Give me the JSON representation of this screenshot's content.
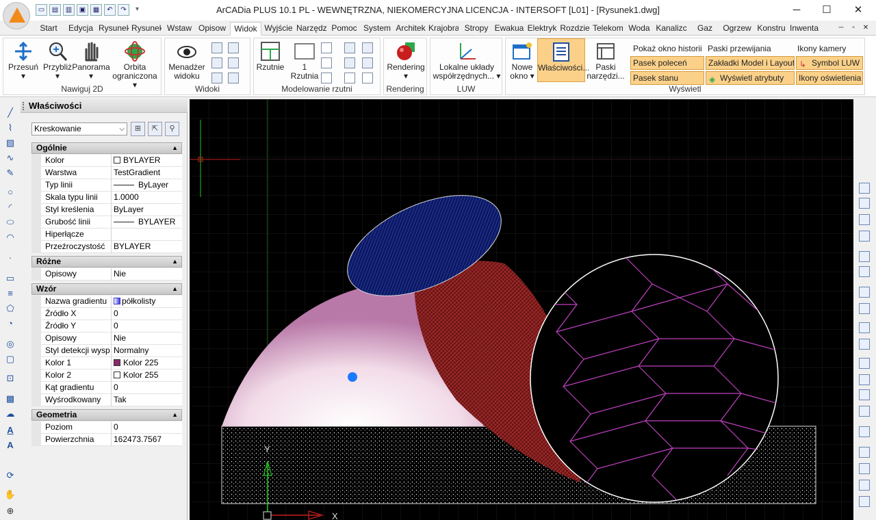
{
  "titlebar": {
    "title": "ArCADia PLUS 10.1 PL - WEWNĘTRZNA, NIEKOMERCYJNA LICENCJA - INTERSOFT [L01] - [Rysunek1.dwg]",
    "minimize": "─",
    "maximize": "☐",
    "close": "✕"
  },
  "tabs": [
    "Start",
    "Edycja",
    "Rysunek",
    "Rysunek",
    "Wstaw",
    "Opisow",
    "Widok",
    "Wyjście",
    "Narzędz",
    "Pomoc",
    "System",
    "Architek",
    "Krajobra",
    "Stropy",
    "Ewakua",
    "Elektryk",
    "Rozdzie",
    "Telekom",
    "Woda",
    "Kanalizc",
    "Gaz",
    "Ogrzew",
    "Konstru",
    "Inwenta"
  ],
  "active_tab": "Widok",
  "ribbon": {
    "nawiguj": {
      "label": "Nawiguj 2D",
      "przesun": "Przesuń",
      "przybliz": "Przybliż",
      "panorama": "Panorama",
      "orbita": "Orbita",
      "ograniczona": "ograniczona"
    },
    "widoki": {
      "label": "Widoki",
      "menedzer": "Menadżer",
      "widoku": "widoku"
    },
    "model": {
      "label": "Modelowanie rzutni",
      "rzutnie": "Rzutnie",
      "jeden": "1",
      "rzutnia": "Rzutnia"
    },
    "rendering": {
      "label": "Rendering",
      "btn": "Rendering"
    },
    "luw": {
      "label": "LUW",
      "lokalne": "Lokalne układy",
      "wspol": "współrzędnych..."
    },
    "wyswietl": {
      "label": "Wyświetl",
      "nowe": "Nowe",
      "okno": "okno",
      "wlasciwosci": "Właściwości...",
      "paski": "Paski",
      "narzedzi": "narzędzi...",
      "pokaz_okno": "Pokaż okno historii",
      "paski_przew": "Paski przewijania",
      "ikony_kamery": "Ikony kamery",
      "pasek_polecen": "Pasek poleceń",
      "zakladki": "Zakładki Model i Layout",
      "symbol_luw": "Symbol LUW",
      "pasek_stanu": "Pasek stanu",
      "wyswietl_atr": "Wyświetl atrybuty",
      "ikony_osw": "Ikony oświetlenia"
    }
  },
  "panel": {
    "title": "Właściwości",
    "selector": "Kreskowanie",
    "sections": [
      {
        "name": "Ogólnie",
        "rows": [
          [
            "Kolor",
            "BYLAYER"
          ],
          [
            "Warstwa",
            "TestGradient"
          ],
          [
            "Typ linii",
            "ByLayer"
          ],
          [
            "Skala typu linii",
            "1.0000"
          ],
          [
            "Styl kreślenia",
            "ByLayer"
          ],
          [
            "Grubość linii",
            "BYLAYER"
          ],
          [
            "Hiperłącze",
            ""
          ],
          [
            "Przeźroczystość",
            "BYLAYER"
          ]
        ]
      },
      {
        "name": "Różne",
        "rows": [
          [
            "Opisowy",
            "Nie"
          ]
        ]
      },
      {
        "name": "Wzór",
        "rows": [
          [
            "Nazwa gradientu",
            "półkolisty"
          ],
          [
            "Źródło X",
            "0"
          ],
          [
            "Źródło Y",
            "0"
          ],
          [
            "Opisowy",
            "Nie"
          ],
          [
            "Styl detekcji wysp",
            "Normalny"
          ],
          [
            "Kolor 1",
            "Kolor 225"
          ],
          [
            "Kolor 2",
            "Kolor 255"
          ],
          [
            "Kąt gradientu",
            "0"
          ],
          [
            "Wyśrodkowany",
            "Tak"
          ]
        ]
      },
      {
        "name": "Geometria",
        "rows": [
          [
            "Poziom",
            "0"
          ],
          [
            "Powierzchnia",
            "162473.7567"
          ]
        ]
      }
    ]
  },
  "canvas": {
    "axis_x": "X",
    "axis_y": "Y",
    "colors": {
      "background": "#000000",
      "grid": "#1e1e1e",
      "ellipse": "#1a2a8a",
      "lens": "#9a2a2a",
      "gradient_center": "#ffffff",
      "gradient_edge": "#c890b8",
      "circle_pattern": "#c040c0",
      "marker": "#1a7aff"
    }
  }
}
